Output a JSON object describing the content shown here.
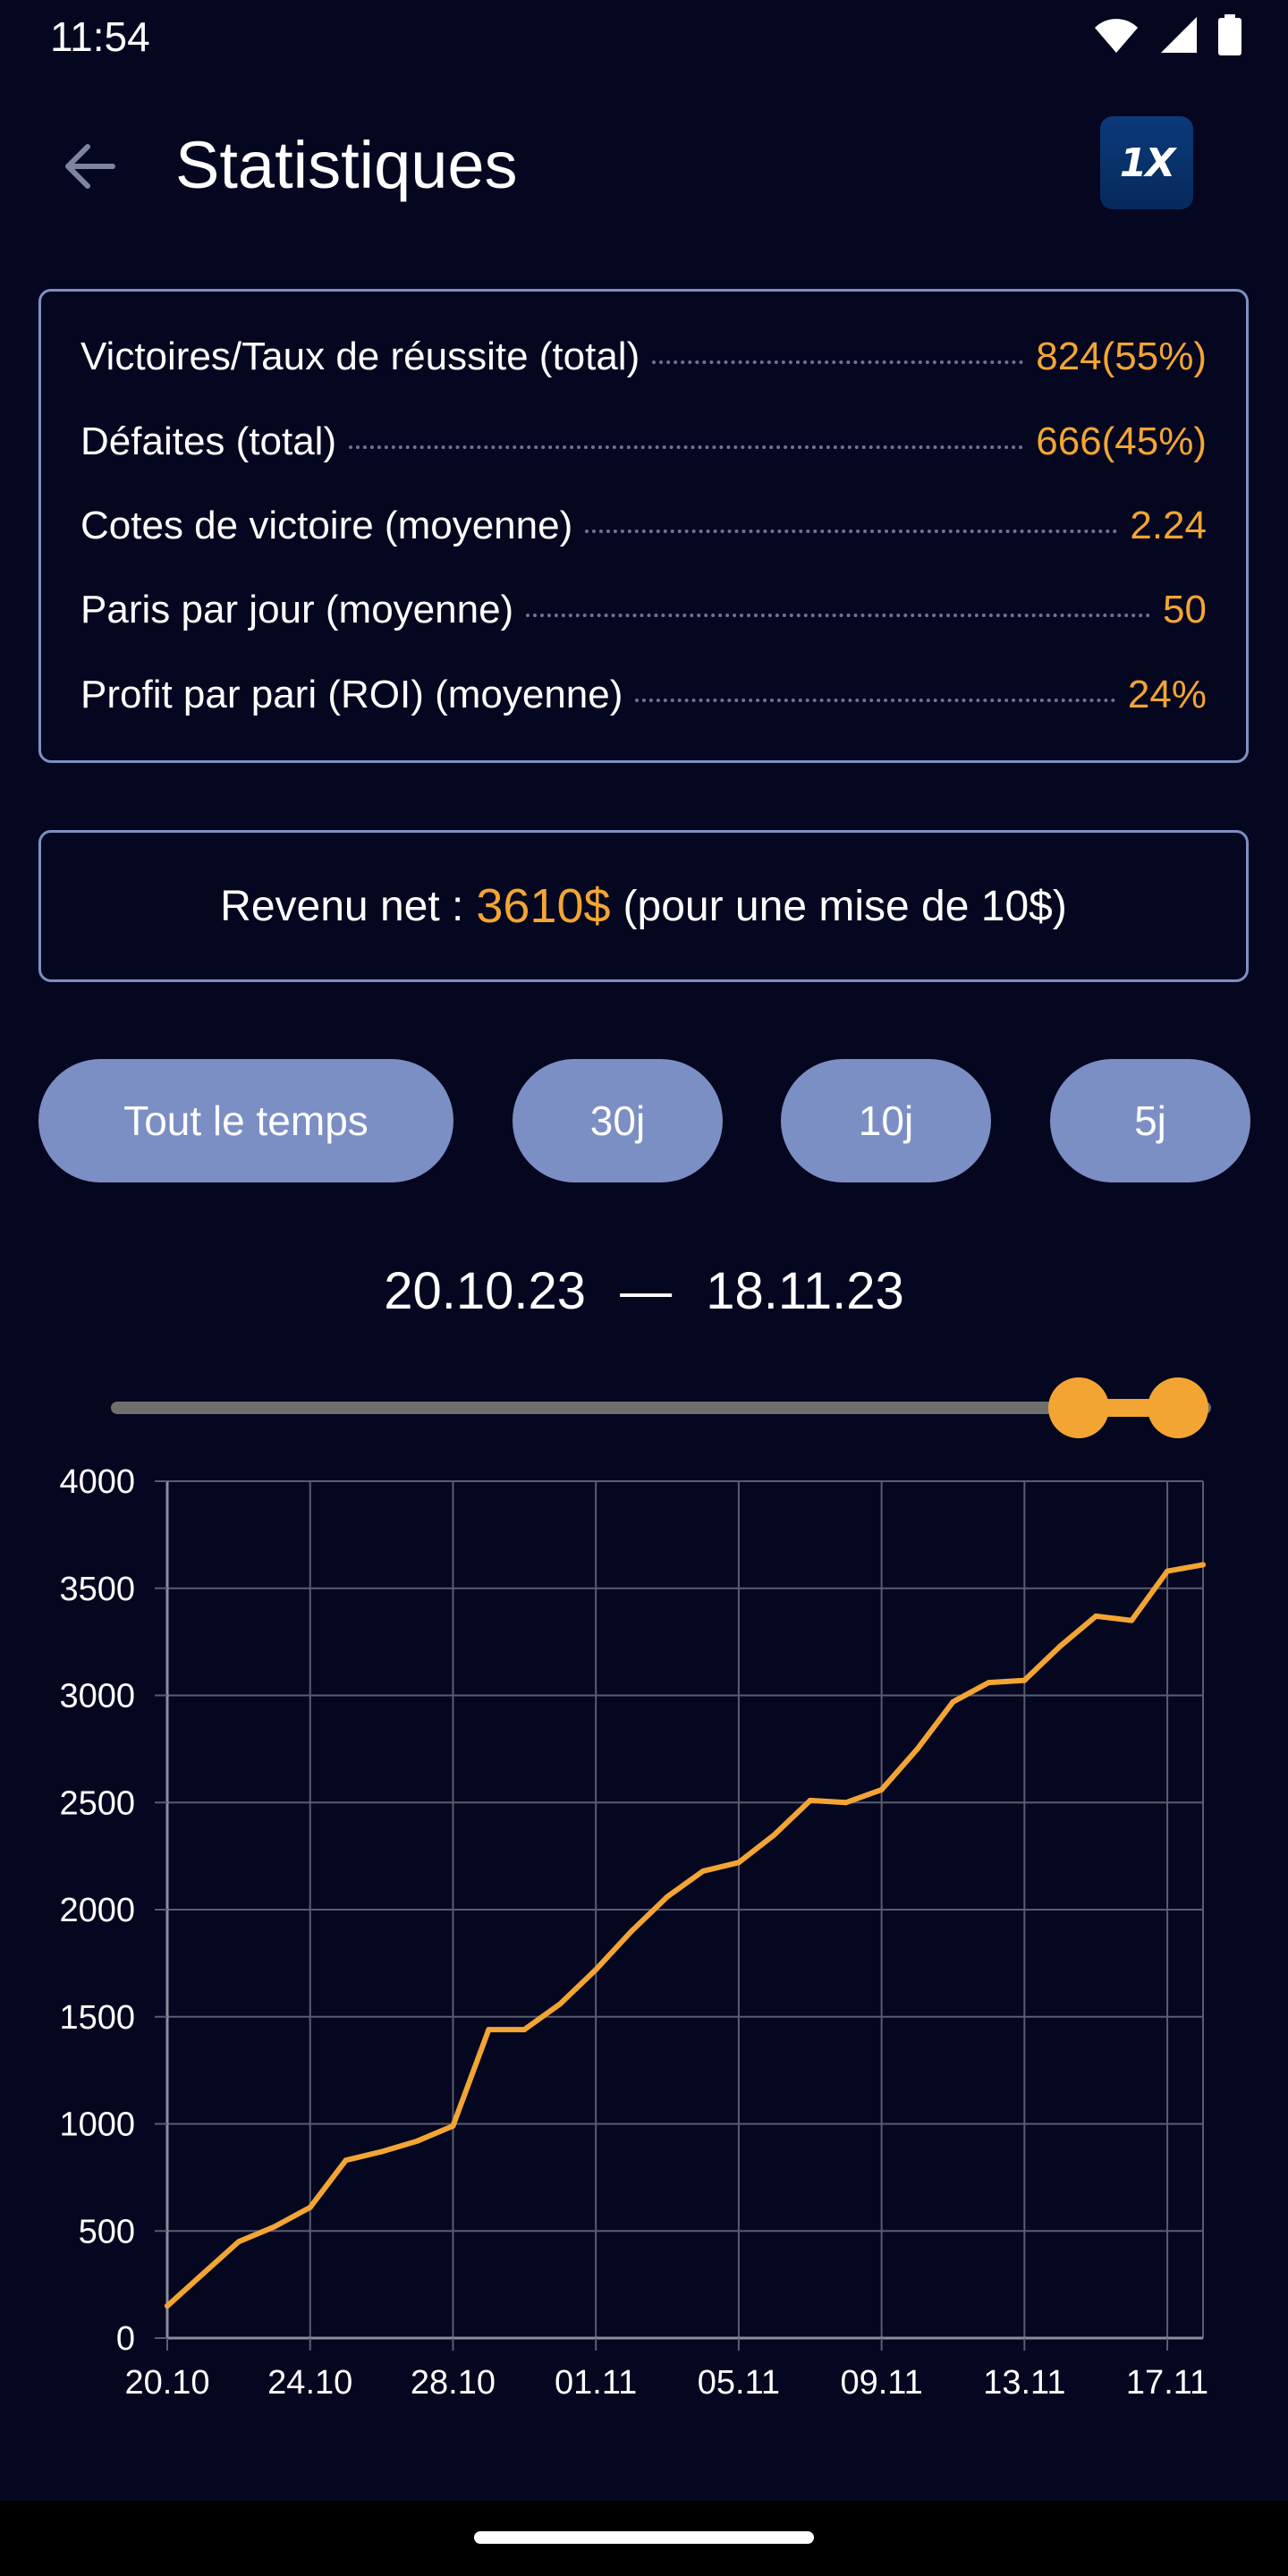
{
  "status_bar": {
    "time": "11:54",
    "icons": [
      "wifi-icon",
      "signal-icon",
      "battery-icon"
    ]
  },
  "header": {
    "title": "Statistiques",
    "back_icon": "arrow-left-icon",
    "logo_text": "1X"
  },
  "stats": [
    {
      "label": "Victoires/Taux de réussite (total)",
      "value": "824(55%)"
    },
    {
      "label": "Défaites (total)",
      "value": "666(45%)"
    },
    {
      "label": "Cotes de victoire (moyenne)",
      "value": "2.24"
    },
    {
      "label": "Paris par jour (moyenne)",
      "value": "50"
    },
    {
      "label": "Profit par pari (ROI) (moyenne)",
      "value": "24%"
    }
  ],
  "revenue": {
    "label": "Revenu net :",
    "amount": "3610$",
    "suffix": "(pour une mise de 10$)"
  },
  "periods": [
    "Tout le temps",
    "30j",
    "10j",
    "5j"
  ],
  "date_range": {
    "start": "20.10.23",
    "separator": "—",
    "end": "18.11.23"
  },
  "slider": {
    "start_fraction": 0.88,
    "end_fraction": 0.97
  },
  "colors": {
    "background": "#05061f",
    "accent": "#f3a533",
    "card_border": "#7d8fc4",
    "button": "#7b8fc4",
    "grid": "#5a5d70"
  },
  "chart_data": {
    "type": "line",
    "title": "",
    "xlabel": "",
    "ylabel": "",
    "ylim": [
      0,
      4000
    ],
    "xlim": [
      "2023-10-20",
      "2023-11-18"
    ],
    "grid": true,
    "yticks": [
      0,
      500,
      1000,
      1500,
      2000,
      2500,
      3000,
      3500,
      4000
    ],
    "xticks": [
      {
        "date": "2023-10-20",
        "label": "20.10"
      },
      {
        "date": "2023-10-24",
        "label": "24.10"
      },
      {
        "date": "2023-10-28",
        "label": "28.10"
      },
      {
        "date": "2023-11-01",
        "label": "01.11"
      },
      {
        "date": "2023-11-05",
        "label": "05.11"
      },
      {
        "date": "2023-11-09",
        "label": "09.11"
      },
      {
        "date": "2023-11-13",
        "label": "13.11"
      },
      {
        "date": "2023-11-17",
        "label": "17.11"
      }
    ],
    "series": [
      {
        "color": "#f3a533",
        "points": [
          {
            "x": "2023-10-20",
            "y": 150
          },
          {
            "x": "2023-10-21",
            "y": 300
          },
          {
            "x": "2023-10-22",
            "y": 450
          },
          {
            "x": "2023-10-23",
            "y": 520
          },
          {
            "x": "2023-10-24",
            "y": 610
          },
          {
            "x": "2023-10-25",
            "y": 830
          },
          {
            "x": "2023-10-26",
            "y": 870
          },
          {
            "x": "2023-10-27",
            "y": 920
          },
          {
            "x": "2023-10-28",
            "y": 990
          },
          {
            "x": "2023-10-29",
            "y": 1440
          },
          {
            "x": "2023-10-30",
            "y": 1440
          },
          {
            "x": "2023-10-31",
            "y": 1560
          },
          {
            "x": "2023-11-01",
            "y": 1720
          },
          {
            "x": "2023-11-02",
            "y": 1900
          },
          {
            "x": "2023-11-03",
            "y": 2060
          },
          {
            "x": "2023-11-04",
            "y": 2180
          },
          {
            "x": "2023-11-05",
            "y": 2220
          },
          {
            "x": "2023-11-06",
            "y": 2350
          },
          {
            "x": "2023-11-07",
            "y": 2510
          },
          {
            "x": "2023-11-08",
            "y": 2500
          },
          {
            "x": "2023-11-09",
            "y": 2560
          },
          {
            "x": "2023-11-10",
            "y": 2750
          },
          {
            "x": "2023-11-11",
            "y": 2970
          },
          {
            "x": "2023-11-12",
            "y": 3060
          },
          {
            "x": "2023-11-13",
            "y": 3070
          },
          {
            "x": "2023-11-14",
            "y": 3230
          },
          {
            "x": "2023-11-15",
            "y": 3370
          },
          {
            "x": "2023-11-16",
            "y": 3350
          },
          {
            "x": "2023-11-17",
            "y": 3580
          },
          {
            "x": "2023-11-18",
            "y": 3610
          }
        ]
      }
    ]
  }
}
